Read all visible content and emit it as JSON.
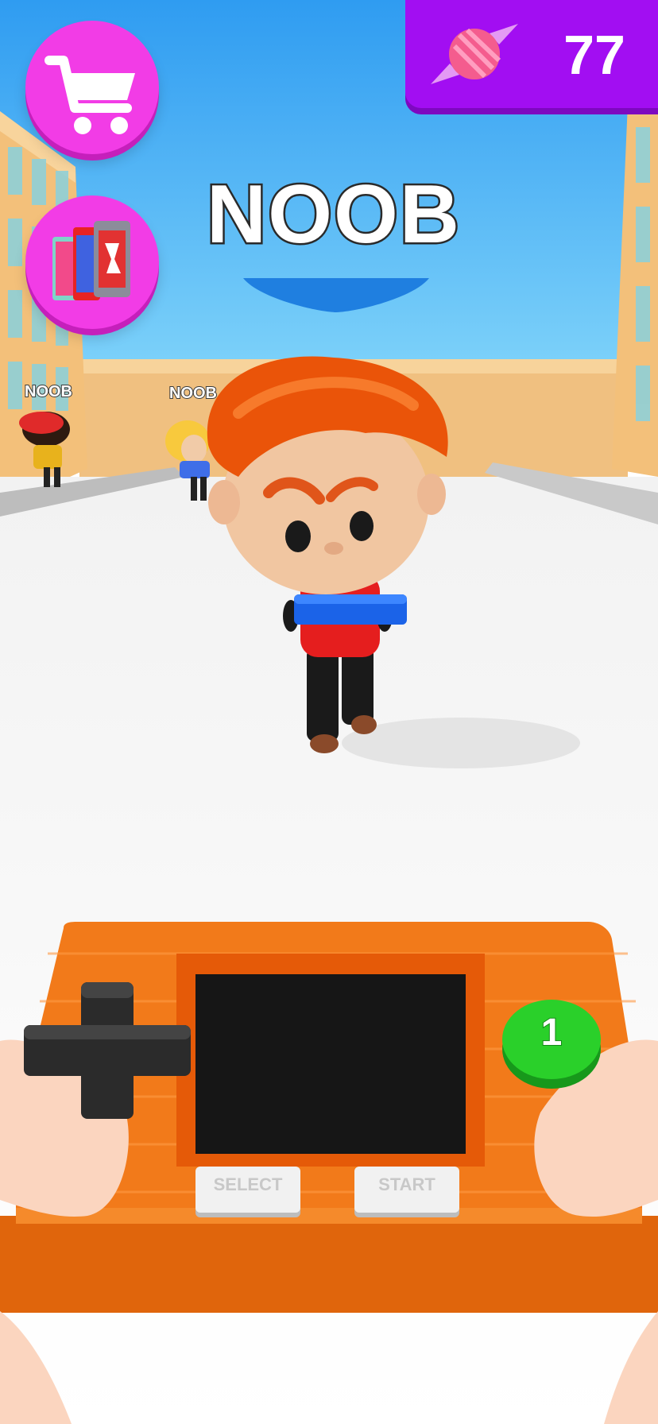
{
  "hud": {
    "currency_value": "77",
    "currency_icon": "candy-icon",
    "shop_icon": "shopping-cart-icon",
    "skins_icon": "card-pack-icon"
  },
  "player": {
    "rank_title": "NOOB"
  },
  "npcs": [
    {
      "tag": "NOOB"
    },
    {
      "tag": "NOOB"
    }
  ],
  "handheld": {
    "select_label": "SELECT",
    "start_label": "START",
    "action_button_label": "1",
    "dpad_icon": "dpad-icon"
  },
  "colors": {
    "sky": "#4fb6f6",
    "accent_pink": "#f23ce6",
    "accent_purple": "#a20ef2",
    "console_orange": "#f27a1a",
    "action_green": "#2ad02a"
  }
}
